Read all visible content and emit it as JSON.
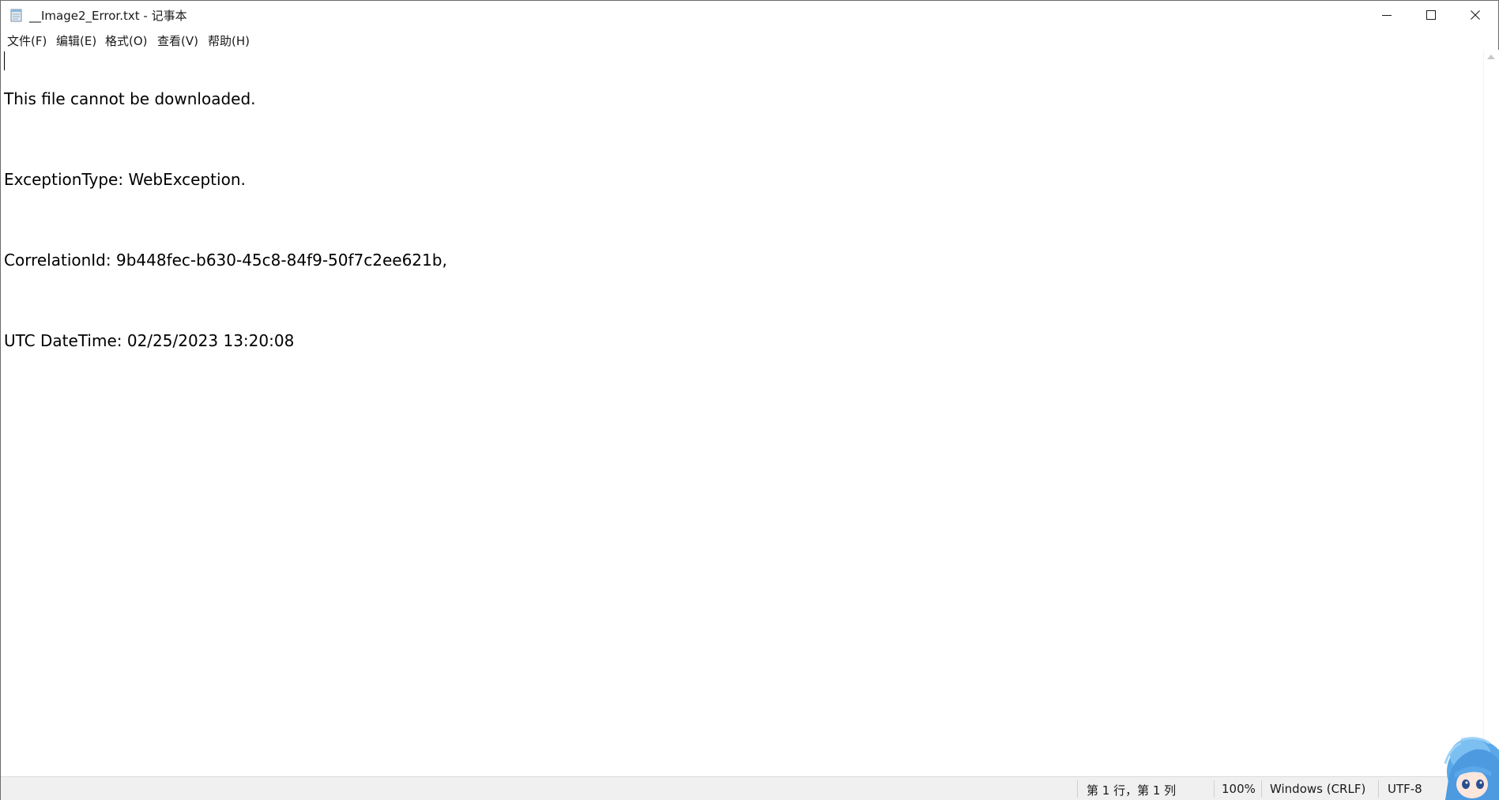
{
  "window": {
    "title": "__Image2_Error.txt - 记事本",
    "app_icon": "notepad-icon",
    "controls": {
      "minimize_icon": "minimize-icon",
      "maximize_icon": "maximize-icon",
      "close_icon": "close-icon"
    }
  },
  "menu": {
    "items": [
      {
        "label": "文件(F)"
      },
      {
        "label": "编辑(E)"
      },
      {
        "label": "格式(O)"
      },
      {
        "label": "查看(V)"
      },
      {
        "label": "帮助(H)"
      }
    ]
  },
  "editor": {
    "lines": [
      "This file cannot be downloaded.",
      "ExceptionType: WebException.",
      "CorrelationId: 9b448fec-b630-45c8-84f9-50f7c2ee621b,",
      "UTC DateTime: 02/25/2023 13:20:08"
    ]
  },
  "statusbar": {
    "position": "第 1 行，第 1 列",
    "zoom": "100%",
    "line_ending": "Windows (CRLF)",
    "encoding": "UTF-8"
  },
  "colors": {
    "statusbar_bg": "#f0f0f0",
    "text": "#000000",
    "mascot_hair": "#5aa8e8"
  }
}
